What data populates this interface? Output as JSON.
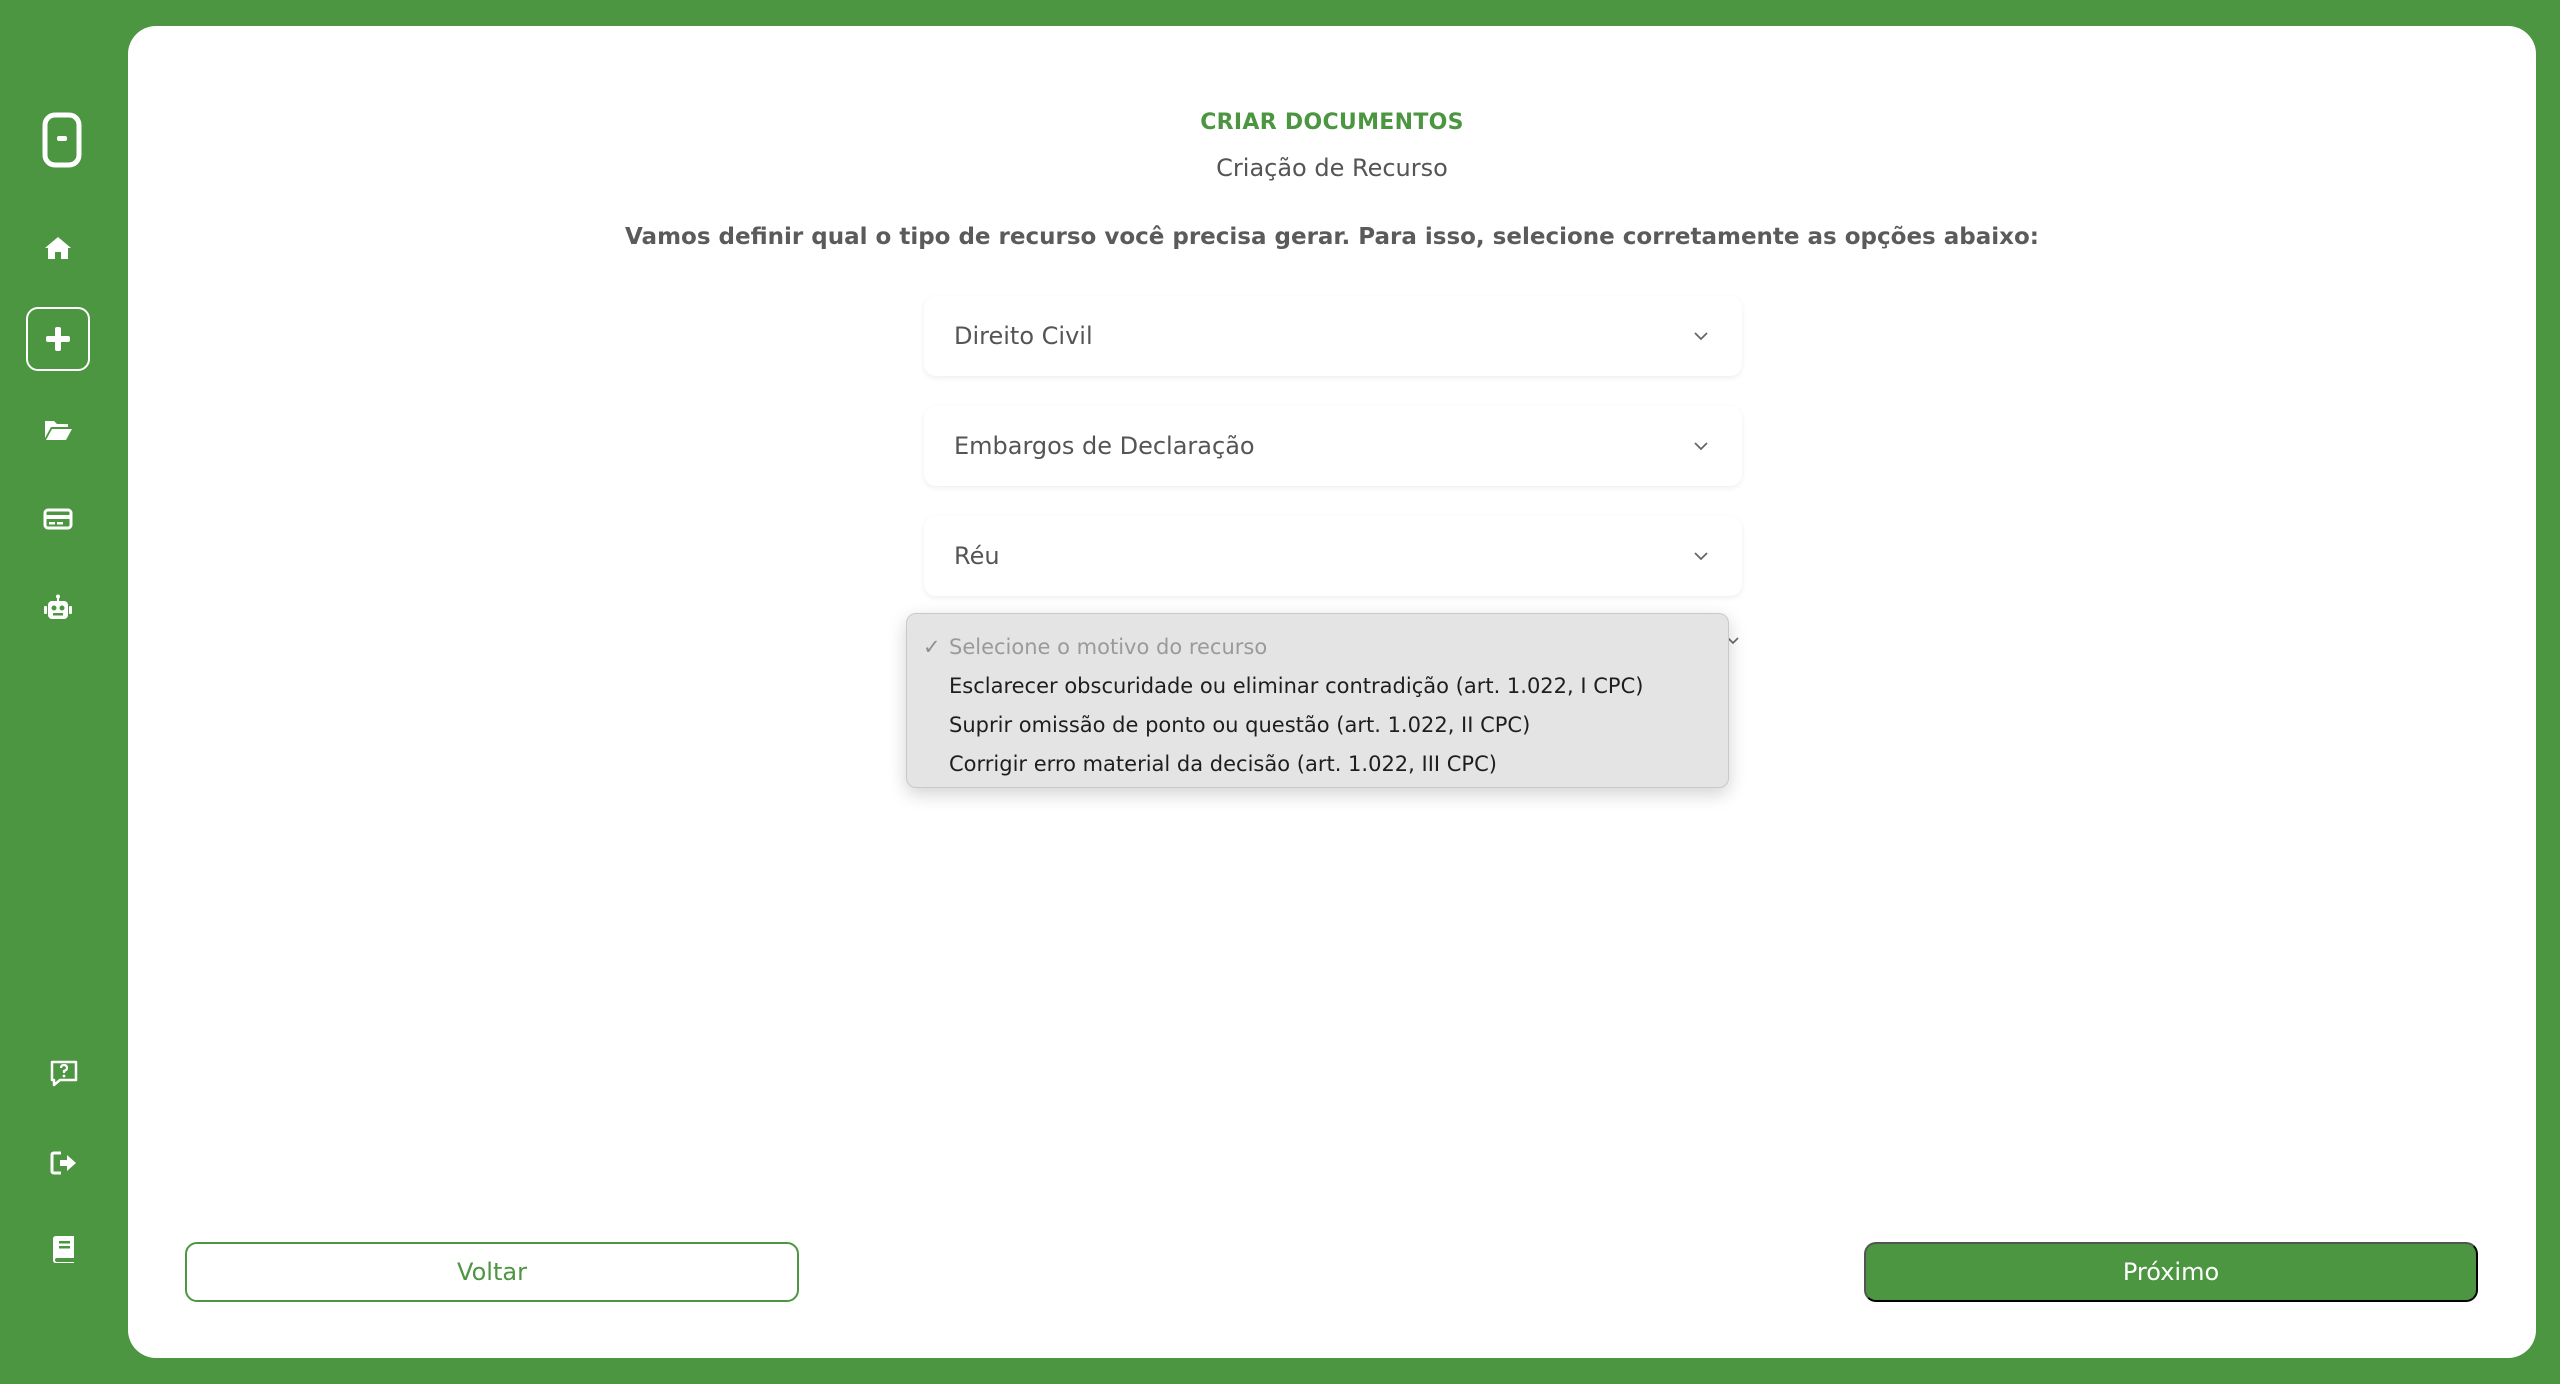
{
  "colors": {
    "brand_green": "#4c9541",
    "card_bg": "#ffffff",
    "text_gray": "#555555",
    "dropdown_bg": "#e4e4e4"
  },
  "sidebar": {
    "logo": "app-logo-icon",
    "items": [
      {
        "icon": "home-icon",
        "active": false
      },
      {
        "icon": "plus-icon",
        "active": true
      },
      {
        "icon": "folder-open-icon",
        "active": false
      },
      {
        "icon": "credit-card-icon",
        "active": false
      },
      {
        "icon": "robot-icon",
        "active": false
      }
    ],
    "bottom_items": [
      {
        "icon": "help-icon"
      },
      {
        "icon": "logout-icon"
      },
      {
        "icon": "book-icon"
      }
    ]
  },
  "header": {
    "eyebrow": "CRIAR DOCUMENTOS",
    "subtitle": "Criação de Recurso",
    "instruction": "Vamos definir qual o tipo de recurso você precisa gerar. Para isso, selecione corretamente as opções abaixo:"
  },
  "form": {
    "area": {
      "value": "Direito Civil"
    },
    "resource_type": {
      "value": "Embargos de Declaração"
    },
    "party": {
      "value": "Réu"
    },
    "reason": {
      "placeholder": "Selecione o motivo do recurso",
      "options": [
        "Esclarecer obscuridade ou eliminar contradição (art. 1.022, I CPC)",
        "Suprir omissão de ponto ou questão (art. 1.022, II CPC)",
        "Corrigir erro material da decisão (art. 1.022, III CPC)"
      ]
    }
  },
  "actions": {
    "back_label": "Voltar",
    "next_label": "Próximo"
  }
}
